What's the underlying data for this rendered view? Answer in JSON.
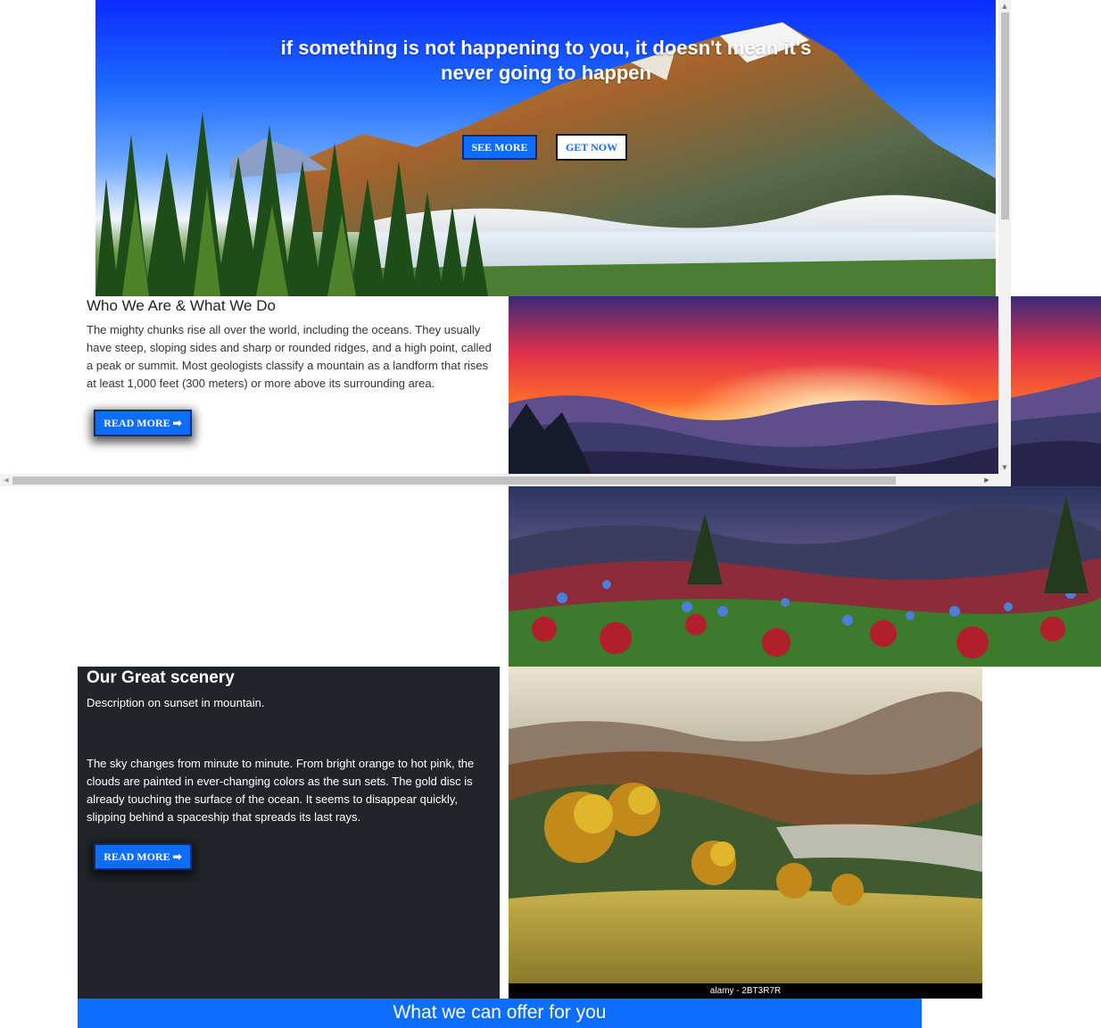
{
  "hero": {
    "quote": "if something is not happening to you, it doesn't mean it's never going to happen",
    "see_more": "SEE MORE",
    "get_now": "GET NOW"
  },
  "who": {
    "title": "Who We Are & What We Do",
    "text": "The mighty chunks rise all over the world, including the oceans. They usually have steep, sloping sides and sharp or rounded ridges, and a high point, called a peak or summit. Most geologists classify a mountain as a landform that rises at least 1,000 feet (300 meters) or more above its surrounding area.",
    "read_more": "READ MORE ➡"
  },
  "scenery": {
    "title": "Our Great scenery",
    "subtitle": "Description on sunset in mountain.",
    "text": "The sky changes from minute to minute. From bright orange to hot pink, the clouds are painted in ever-changing colors as the sun sets. The gold disc is already touching the surface of the ocean. It seems to disappear quickly, slipping behind a spaceship that spreads its last rays.",
    "read_more": "READ MORE ➡",
    "image_caption": "alamy - 2BT3R7R"
  },
  "offer": {
    "title": "What we can offer for you"
  },
  "scrollbars": {
    "up": "▲",
    "down": "▼",
    "left": "◀",
    "right": "▶"
  },
  "icons": [
    "arrow-right-icon"
  ],
  "colors": {
    "primary": "#0d6efd",
    "dark_panel": "#212529"
  }
}
